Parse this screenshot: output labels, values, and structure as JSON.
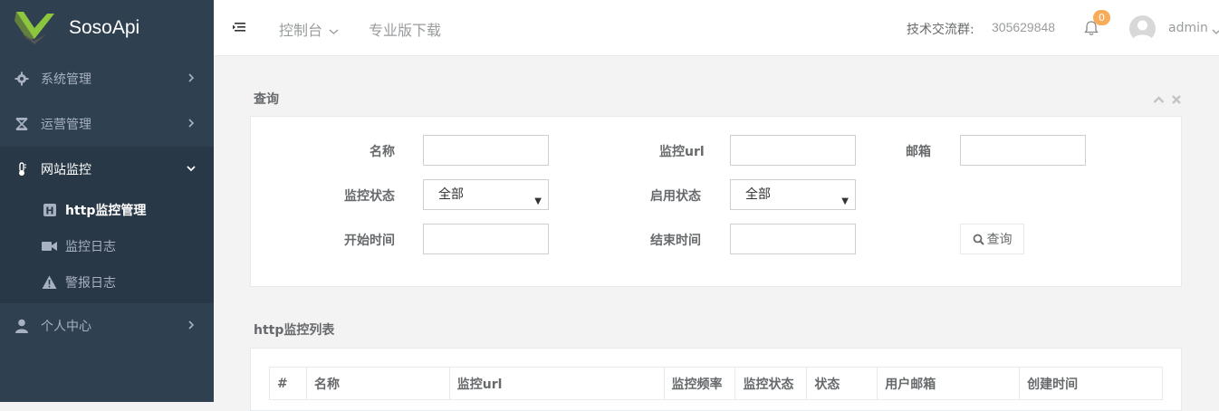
{
  "app": {
    "brand": "SosoApi"
  },
  "sidebar": {
    "items": [
      {
        "label": "系统管理",
        "icon": "gear-icon"
      },
      {
        "label": "运营管理",
        "icon": "hourglass-icon"
      },
      {
        "label": "网站监控",
        "icon": "thermometer-icon",
        "expanded": true
      },
      {
        "label": "个人中心",
        "icon": "user-icon"
      }
    ],
    "submenu": [
      {
        "label": "http监控管理",
        "icon": "h-square-icon",
        "active": true
      },
      {
        "label": "监控日志",
        "icon": "video-camera-icon"
      },
      {
        "label": "警报日志",
        "icon": "warning-icon"
      }
    ]
  },
  "topbar": {
    "console": "控制台",
    "download": "专业版下载",
    "qq_label": "技术交流群:",
    "qq_number": "305629848",
    "notification_count": "0",
    "username": "admin"
  },
  "query": {
    "title": "查询",
    "labels": {
      "name": "名称",
      "url": "监控url",
      "email": "邮箱",
      "monitor_status": "监控状态",
      "enable_status": "启用状态",
      "start_time": "开始时间",
      "end_time": "结束时间"
    },
    "monitor_status_value": "全部",
    "enable_status_value": "全部",
    "search_button": "查询"
  },
  "list": {
    "title": "http监控列表",
    "columns": [
      "#",
      "名称",
      "监控url",
      "监控频率",
      "监控状态",
      "状态",
      "用户邮箱",
      "创建时间"
    ]
  },
  "colors": {
    "sidebar": "#2f4050",
    "sidebar_active": "#293846",
    "badge": "#f8ac59",
    "logo_green": "#8cc63e"
  }
}
